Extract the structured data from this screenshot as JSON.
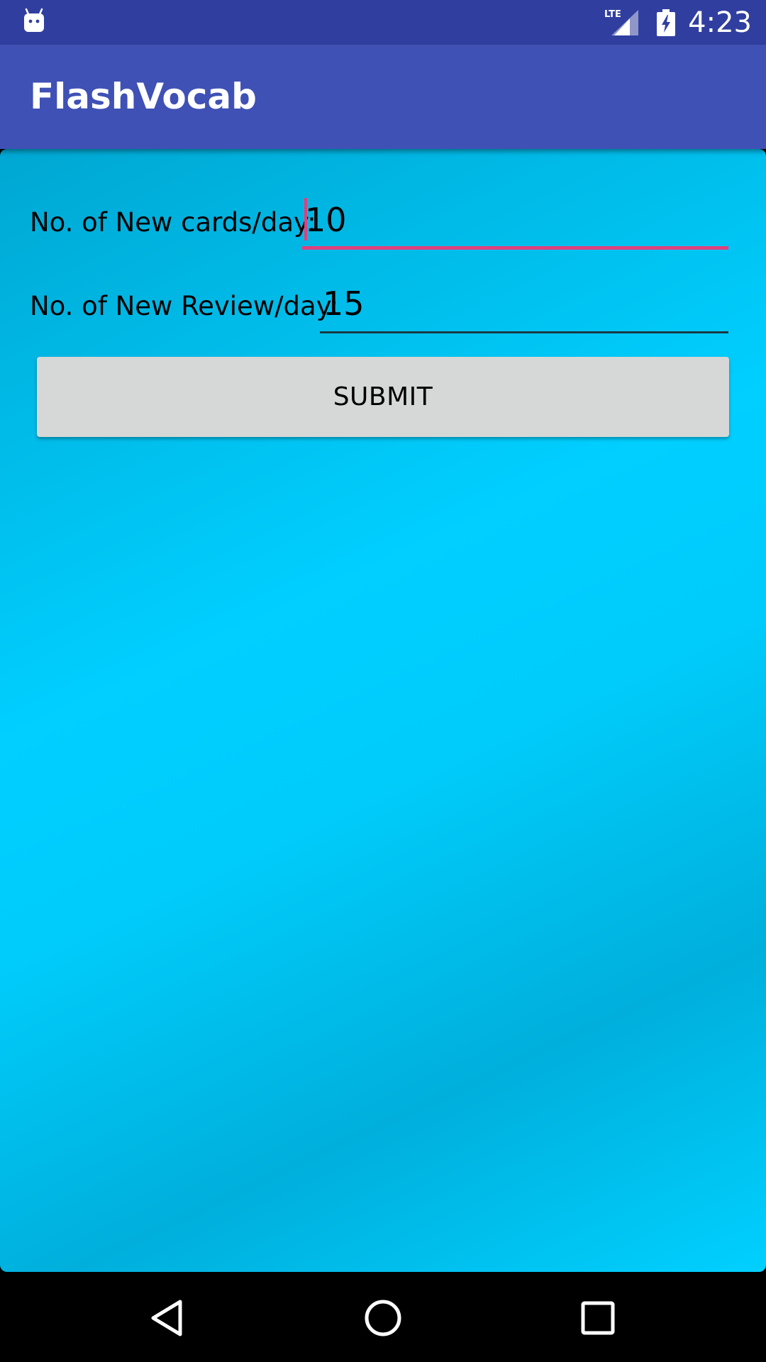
{
  "status_bar": {
    "time": "4:23",
    "network_label": "LTE",
    "icons": [
      "android-icon",
      "lte-signal-icon",
      "battery-charging-icon"
    ]
  },
  "app_bar": {
    "title": "FlashVocab"
  },
  "form": {
    "new_cards_label": "No. of New cards/day:",
    "new_cards_value": "10",
    "new_review_label": "No. of New Review/day:",
    "new_review_value": "15",
    "submit_label": "SUBMIT"
  },
  "nav_bar": {
    "icons": [
      "back-icon",
      "home-icon",
      "recents-icon"
    ]
  },
  "colors": {
    "status_bar": "#303F9F",
    "app_bar": "#3F51B5",
    "accent": "#E0407E",
    "content_light": "#00CFFF",
    "content_dark": "#00A7D2",
    "button": "#D6D7D7"
  }
}
